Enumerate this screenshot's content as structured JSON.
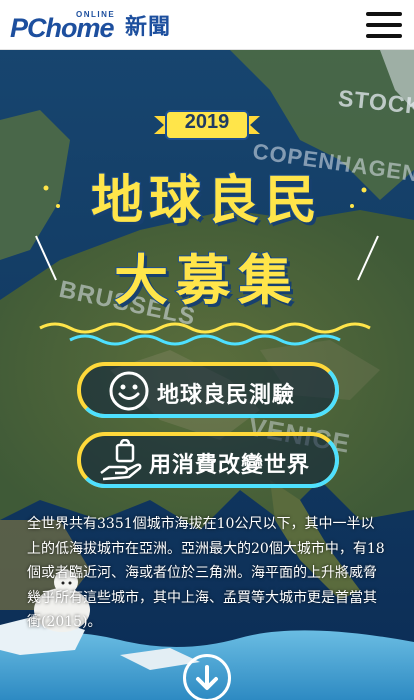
{
  "header": {
    "logo": {
      "brand_pc": "PC",
      "brand_home": "home",
      "online": "ONLINE",
      "news": "新聞"
    },
    "menu_icon": "hamburger-menu-icon"
  },
  "hero": {
    "map_labels": {
      "stockholm": "STOCKH",
      "copenhagen": "COPENHAGEN",
      "brussels": "BRUSSELS",
      "venice": "VENICE"
    },
    "year": "2019",
    "title_line1": "地球良民",
    "title_line2": "大募集",
    "buttons": [
      {
        "label": "地球良民測驗",
        "icon": "smiley-face-icon"
      },
      {
        "label": "用消費改變世界",
        "icon": "hand-shopping-bag-icon"
      }
    ],
    "body": "全世界共有3351個城市海拔在10公尺以下，其中一半以上的低海拔城市在亞洲。亞洲最大的20個大城市中，有18個或者臨近河、海或者位於三角洲。海平面的上升將威脅幾乎所有這些城市，其中上海、孟買等大城市更是首當其衝(2015)。",
    "scroll_icon": "arrow-down-circle-icon"
  },
  "colors": {
    "brand_blue": "#1d4f9e",
    "title_yellow": "#ffe54a",
    "accent_cyan": "#4ee0ff",
    "button_yellow": "#ffd93a"
  }
}
